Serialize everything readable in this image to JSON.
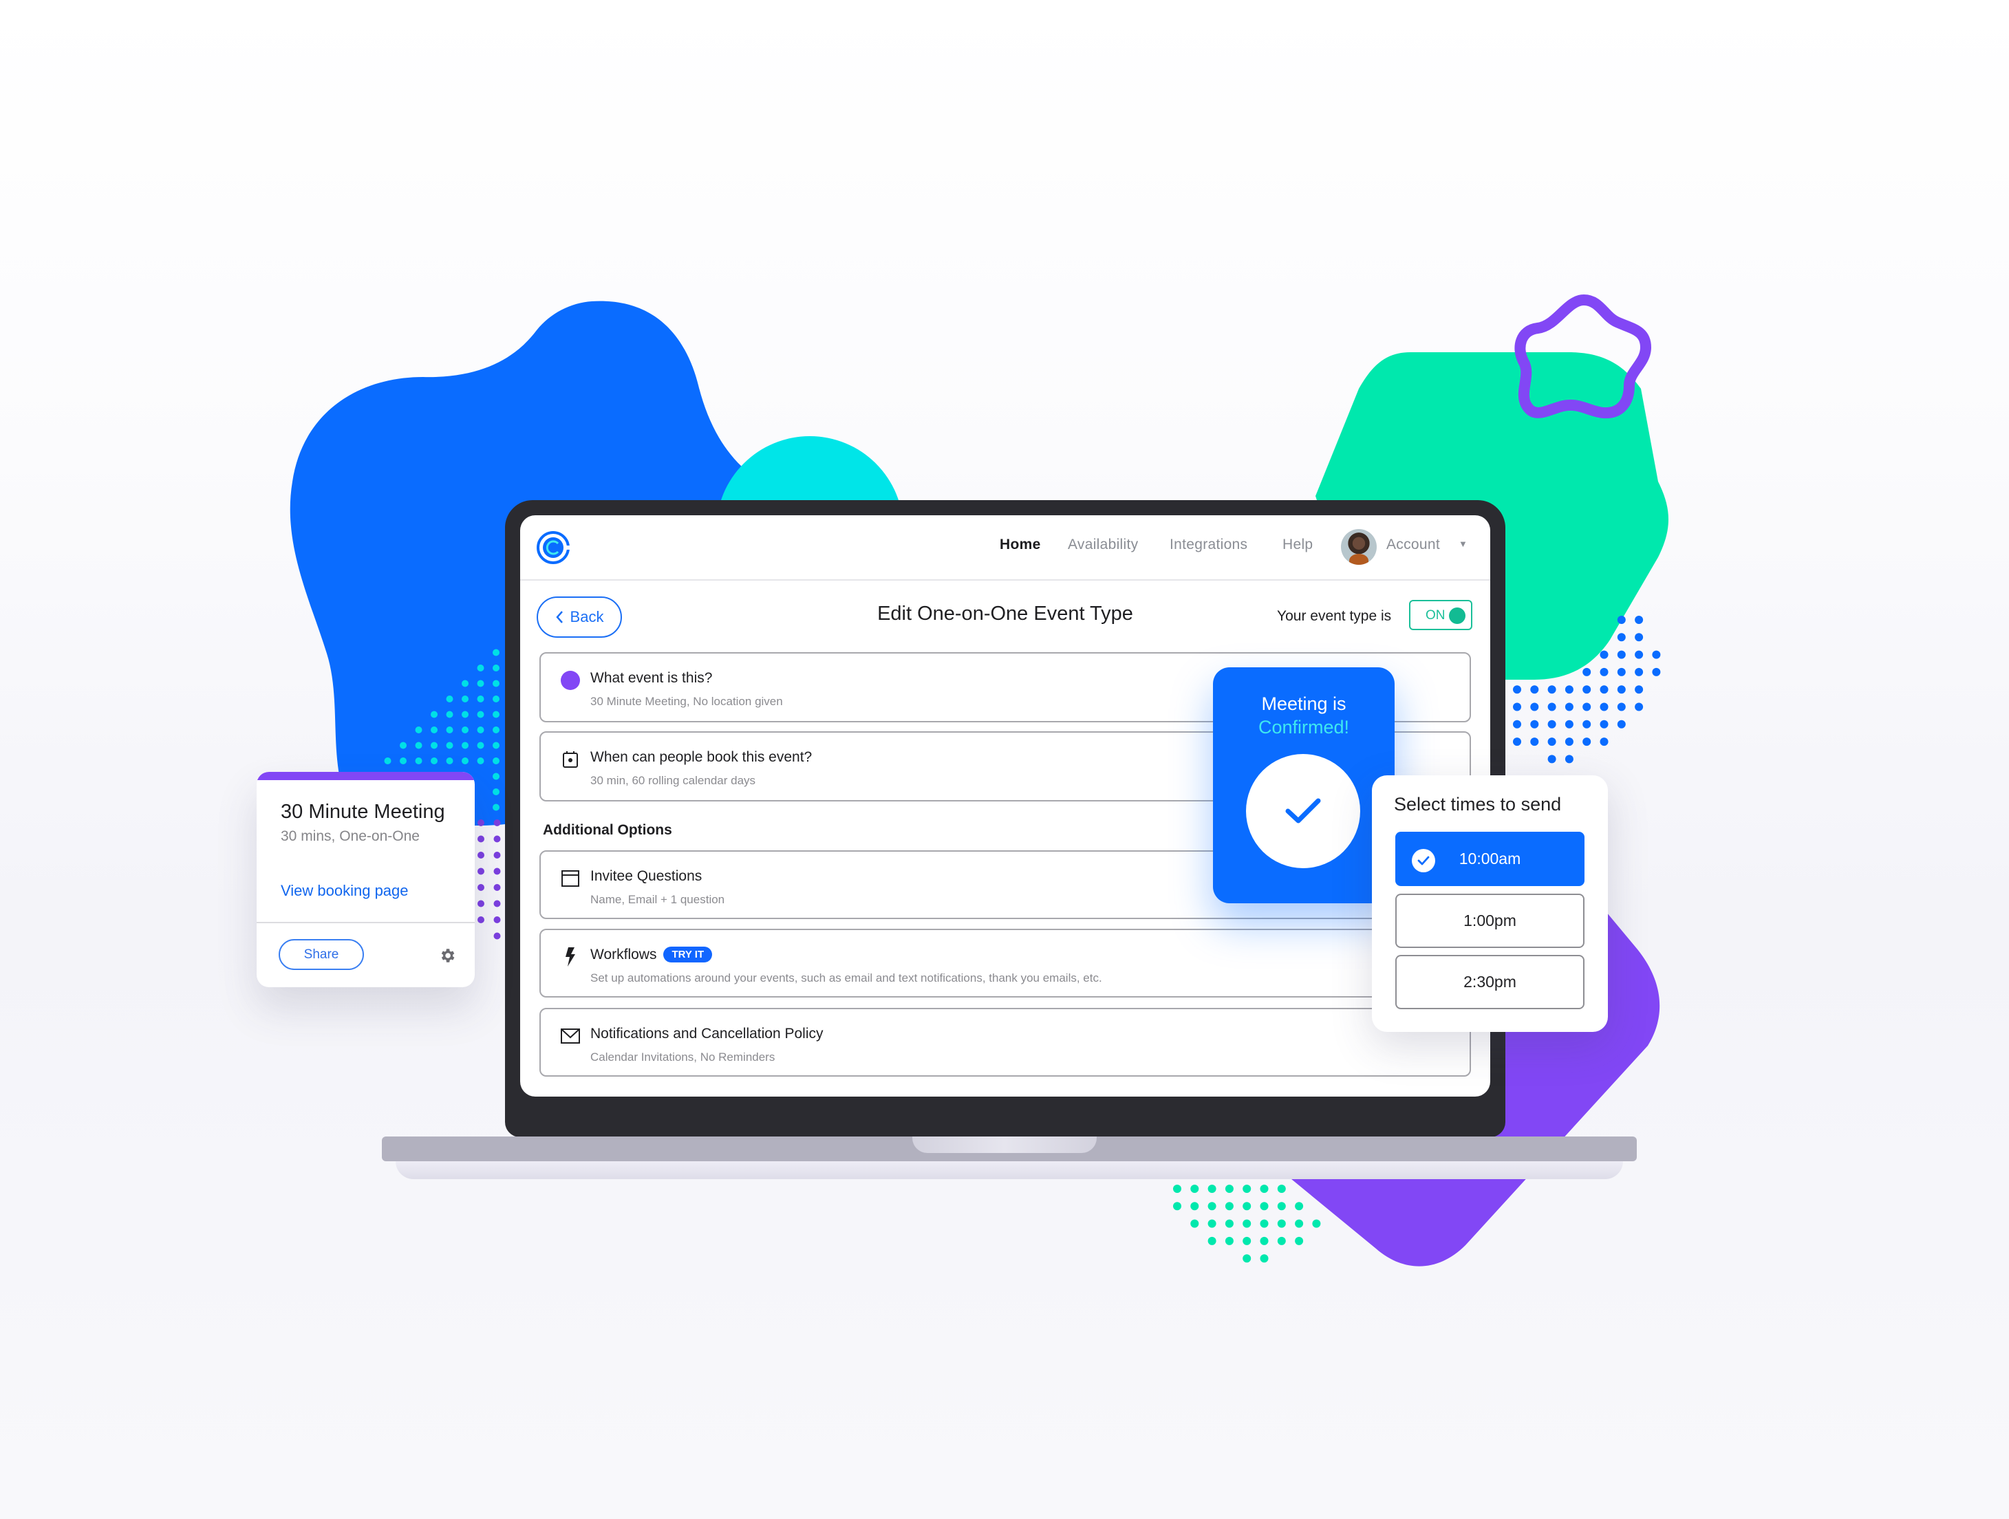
{
  "brand": {
    "logo_icon": "calendly-logo-icon",
    "accent": "#0a6cff",
    "purple": "#8247f5",
    "green": "#00e8ad",
    "cyan": "#00e5e8"
  },
  "nav": {
    "items": [
      {
        "label": "Home",
        "active": true
      },
      {
        "label": "Availability",
        "active": false
      },
      {
        "label": "Integrations",
        "active": false
      },
      {
        "label": "Help",
        "active": false
      }
    ],
    "account_label": "Account",
    "caret": "▼"
  },
  "title_row": {
    "back_label": "Back",
    "page_title": "Edit One-on-One Event Type",
    "event_type_label": "Your event type is",
    "toggle_label": "ON",
    "toggle_on": true
  },
  "rows": [
    {
      "icon": "purple-dot-icon",
      "title": "What event is this?",
      "subtitle": "30 Minute Meeting, No location given"
    },
    {
      "icon": "calendar-icon",
      "title": "When can people book this event?",
      "subtitle": "30 min, 60 rolling calendar days"
    }
  ],
  "additional_options": {
    "label": "Additional Options",
    "rows": [
      {
        "icon": "form-icon",
        "title": "Invitee Questions",
        "subtitle": "Name, Email + 1 question"
      },
      {
        "icon": "lightning-icon",
        "title": "Workflows",
        "badge": "TRY IT",
        "subtitle": "Set up automations around your events, such as email and text notifications, thank you emails, etc."
      },
      {
        "icon": "envelope-icon",
        "title": "Notifications and Cancellation Policy",
        "subtitle": "Calendar Invitations, No Reminders"
      }
    ]
  },
  "meeting_card": {
    "title": "30 Minute Meeting",
    "subtitle": "30 mins, One-on-One",
    "link": "View booking page",
    "share_label": "Share",
    "gear_icon": "gear-icon"
  },
  "confirmation": {
    "line1": "Meeting is",
    "line2": "Confirmed!",
    "icon": "checkmark-icon"
  },
  "times": {
    "title": "Select times to send",
    "slots": [
      {
        "label": "10:00am",
        "selected": true
      },
      {
        "label": "1:00pm",
        "selected": false
      },
      {
        "label": "2:30pm",
        "selected": false
      }
    ]
  }
}
